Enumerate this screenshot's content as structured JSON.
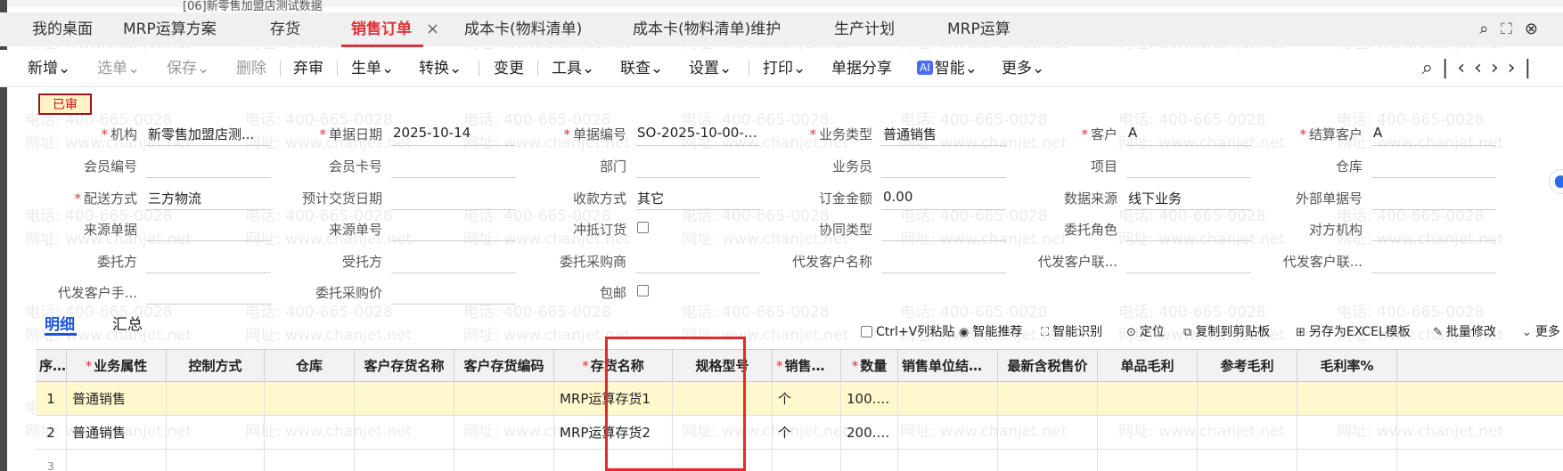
{
  "window": {
    "title": "[06]新零售加盟店测试数据"
  },
  "tabs": [
    {
      "label": "我的桌面"
    },
    {
      "label": "MRP运算方案"
    },
    {
      "label": "存货"
    },
    {
      "label": "销售订单",
      "active": true
    },
    {
      "label": "成本卡(物料清单)"
    },
    {
      "label": "成本卡(物料清单)维护"
    },
    {
      "label": "生产计划"
    },
    {
      "label": "MRP运算"
    }
  ],
  "tab_close": "×",
  "toolbar": {
    "new": "新增",
    "select": "选单",
    "save": "保存",
    "delete": "删除",
    "unapprove": "弃审",
    "generate": "生单",
    "convert": "转换",
    "change": "变更",
    "tools": "工具",
    "query": "联查",
    "settings": "设置",
    "print": "打印",
    "share": "单据分享",
    "ai_badge": "AI",
    "ai": "智能",
    "more": "更多",
    "dropdown_glyph": "⌄"
  },
  "status_badge": "已审",
  "form": {
    "org": {
      "label": "机构",
      "value": "新零售加盟店测...",
      "required": true
    },
    "date": {
      "label": "单据日期",
      "value": "2025-10-14",
      "required": true
    },
    "doc_no": {
      "label": "单据编号",
      "value": "SO-2025-10-00-00...",
      "required": true
    },
    "biz_type": {
      "label": "业务类型",
      "value": "普通销售",
      "required": true
    },
    "customer": {
      "label": "客户",
      "value": "A",
      "required": true
    },
    "settle_customer": {
      "label": "结算客户",
      "value": "A",
      "required": true
    },
    "member_no": {
      "label": "会员编号",
      "value": ""
    },
    "member_card": {
      "label": "会员卡号",
      "value": ""
    },
    "dept": {
      "label": "部门",
      "value": ""
    },
    "salesman": {
      "label": "业务员",
      "value": ""
    },
    "project": {
      "label": "项目",
      "value": ""
    },
    "warehouse": {
      "label": "仓库",
      "value": ""
    },
    "delivery": {
      "label": "配送方式",
      "value": "三方物流",
      "required": true
    },
    "expected_date": {
      "label": "预计交货日期",
      "value": ""
    },
    "payment": {
      "label": "收款方式",
      "value": "其它"
    },
    "amount": {
      "label": "订金金额",
      "value": "0.00"
    },
    "data_source": {
      "label": "数据来源",
      "value": "线下业务"
    },
    "ext_doc_no": {
      "label": "外部单据号",
      "value": ""
    },
    "src_doc": {
      "label": "来源单据",
      "value": ""
    },
    "src_no": {
      "label": "来源单号",
      "value": ""
    },
    "offset_order": {
      "label": "冲抵订货",
      "value": ""
    },
    "contract_type": {
      "label": "协同类型",
      "value": ""
    },
    "entrust_role": {
      "label": "委托角色",
      "value": ""
    },
    "counter_org": {
      "label": "对方机构",
      "value": ""
    },
    "entruster": {
      "label": "委托方",
      "value": ""
    },
    "entrustee": {
      "label": "受托方",
      "value": ""
    },
    "entrust_buyer": {
      "label": "委托采购商",
      "value": ""
    },
    "ship_customer_name": {
      "label": "代发客户名称",
      "value": ""
    },
    "ship_customer_contact": {
      "label": "代发客户联...",
      "value": ""
    },
    "ship_customer_contact2": {
      "label": "代发客户联...",
      "value": ""
    },
    "ship_customer_phone": {
      "label": "代发客户手...",
      "value": ""
    },
    "entrust_price": {
      "label": "委托采购价",
      "value": ""
    },
    "free_shipping": {
      "label": "包邮",
      "value": ""
    }
  },
  "subtabs": {
    "detail": "明细",
    "summary": "汇总"
  },
  "grid_tools": {
    "paste": "Ctrl+V列粘贴",
    "recommend": "智能推荐",
    "recognize": "智能识别",
    "locate": "定位",
    "copy": "复制到剪贴板",
    "export": "另存为EXCEL模板",
    "batch": "批量修改",
    "more": "更多"
  },
  "grid": {
    "columns": [
      {
        "label": "序号"
      },
      {
        "label": "业务属性",
        "required": true
      },
      {
        "label": "控制方式"
      },
      {
        "label": "仓库"
      },
      {
        "label": "客户存货名称"
      },
      {
        "label": "客户存货编码"
      },
      {
        "label": "存货名称",
        "required": true
      },
      {
        "label": "规格型号"
      },
      {
        "label": "销售单位",
        "required": true
      },
      {
        "label": "数量",
        "required": true
      },
      {
        "label": "销售单位结存..."
      },
      {
        "label": "最新含税售价"
      },
      {
        "label": "单品毛利"
      },
      {
        "label": "参考毛利"
      },
      {
        "label": "毛利率%"
      }
    ],
    "rows": [
      {
        "no": "1",
        "biz": "普通销售",
        "name": "MRP运算存货1",
        "unit": "个",
        "qty": "100.0..."
      },
      {
        "no": "2",
        "biz": "普通销售",
        "name": "MRP运算存货2",
        "unit": "个",
        "qty": "200.0..."
      },
      {
        "no": "3",
        "biz": "",
        "name": "",
        "unit": "",
        "qty": ""
      }
    ]
  },
  "watermark": {
    "phone": "电话: 400-665-0028",
    "site": "网址: www.chanjet.net"
  }
}
